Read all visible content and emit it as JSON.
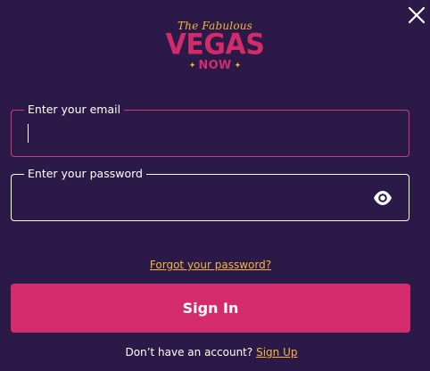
{
  "logo": {
    "tagline": "The Fabulous",
    "main": "VEGAS",
    "sub": "NOW"
  },
  "close": {
    "icon": "close-icon"
  },
  "email": {
    "label": "Enter your email",
    "value": "",
    "placeholder": ""
  },
  "password": {
    "label": "Enter your password",
    "value": "",
    "placeholder": "",
    "toggle_icon": "eye-icon"
  },
  "forgot_password": "Forgot your password?",
  "sign_in_button": "Sign In",
  "signup": {
    "prompt": "Don’t have an account?",
    "link": "Sign Up"
  },
  "colors": {
    "background": "#2b1a47",
    "accent_pink": "#d42b6c",
    "accent_gold": "#f4b63d",
    "text": "#ffffff"
  }
}
